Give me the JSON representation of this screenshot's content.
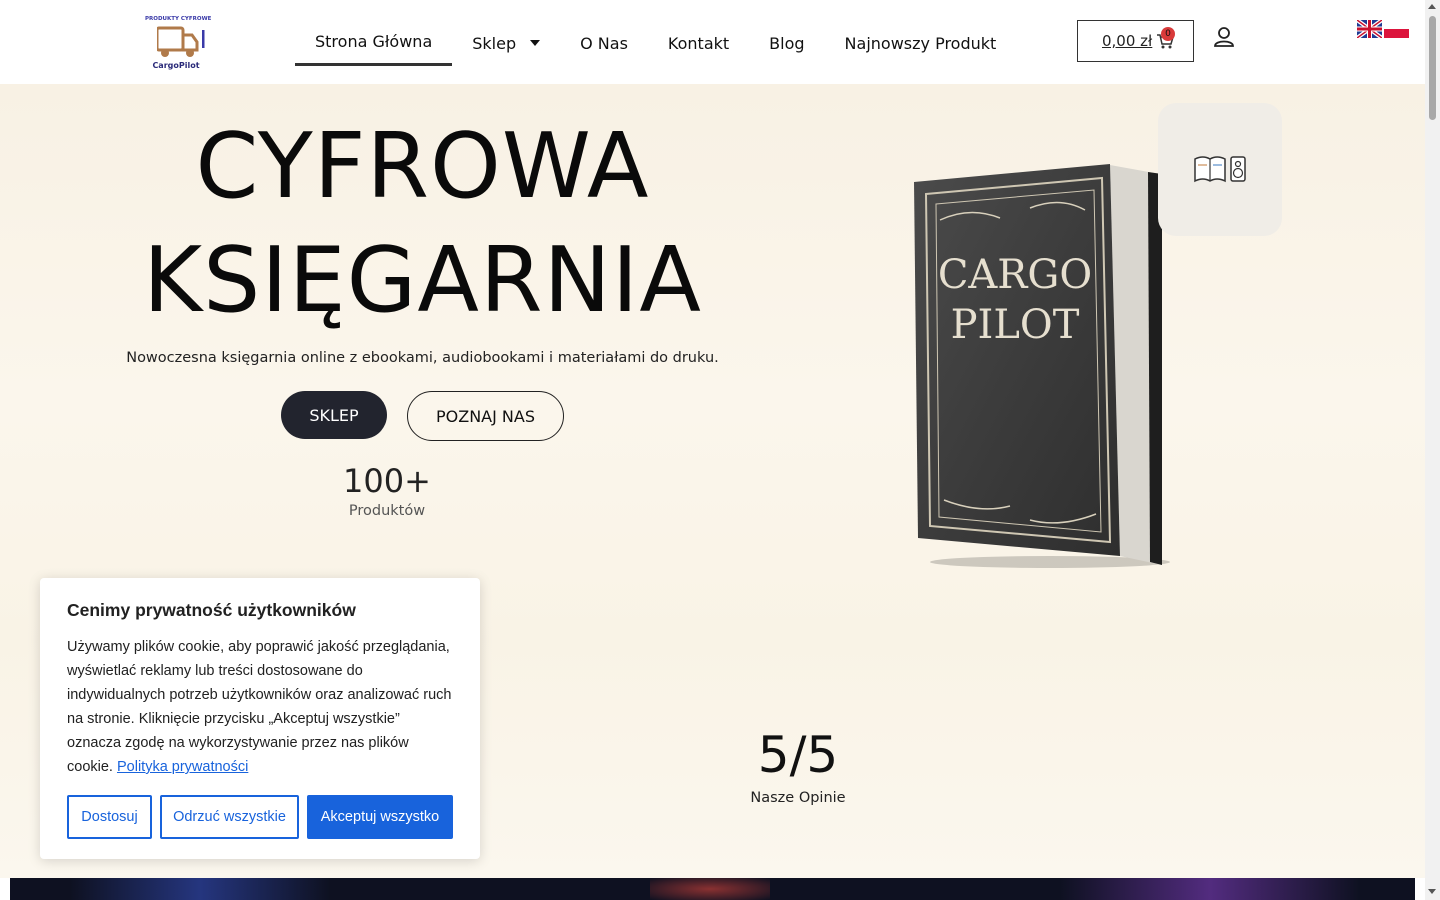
{
  "header": {
    "logo": {
      "top_text": "PRODUKTY CYFROWE",
      "bottom_text": "CargoPilot"
    },
    "nav": [
      {
        "label": "Strona Główna",
        "active": true
      },
      {
        "label": "Sklep",
        "has_dropdown": true
      },
      {
        "label": "O Nas"
      },
      {
        "label": "Kontakt"
      },
      {
        "label": "Blog"
      },
      {
        "label": "Najnowszy Produkt"
      }
    ],
    "cart": {
      "total": "0,00 zł",
      "count": "0"
    },
    "languages": [
      "en-flag-icon",
      "pl-flag-icon"
    ]
  },
  "hero": {
    "title_line1": "CYFROWA",
    "title_line2": "KSIĘGARNIA",
    "subtitle": "Nowoczesna księgarnia online z ebookami, audiobookami i materiałami do druku.",
    "btn_primary": "SKLEP",
    "btn_secondary": "POZNAJ NAS",
    "stat_number": "100+",
    "stat_label": "Produktów",
    "book_title_line1": "CARGO",
    "book_title_line2": "PILOT",
    "rating_number": "5/5",
    "rating_label": "Nasze Opinie"
  },
  "cookie": {
    "title": "Cenimy prywatność użytkowników",
    "text": "Używamy plików cookie, aby poprawić jakość przeglądania, wyświetlać reklamy lub treści dostosowane do indywidualnych potrzeb użytkowników oraz analizować ruch na stronie. Kliknięcie przycisku „Akceptuj wszystkie” oznacza zgodę na wykorzystywanie przez nas plików cookie.",
    "link": "Polityka prywatności",
    "btn_customize": "Dostosuj",
    "btn_reject": "Odrzuć wszystkie",
    "btn_accept": "Akceptuj wszystko"
  },
  "colors": {
    "accent": "#1863dc",
    "dark_button": "#22242e",
    "badge": "#d93a3a",
    "hero_bg": "#f8f1e4"
  }
}
